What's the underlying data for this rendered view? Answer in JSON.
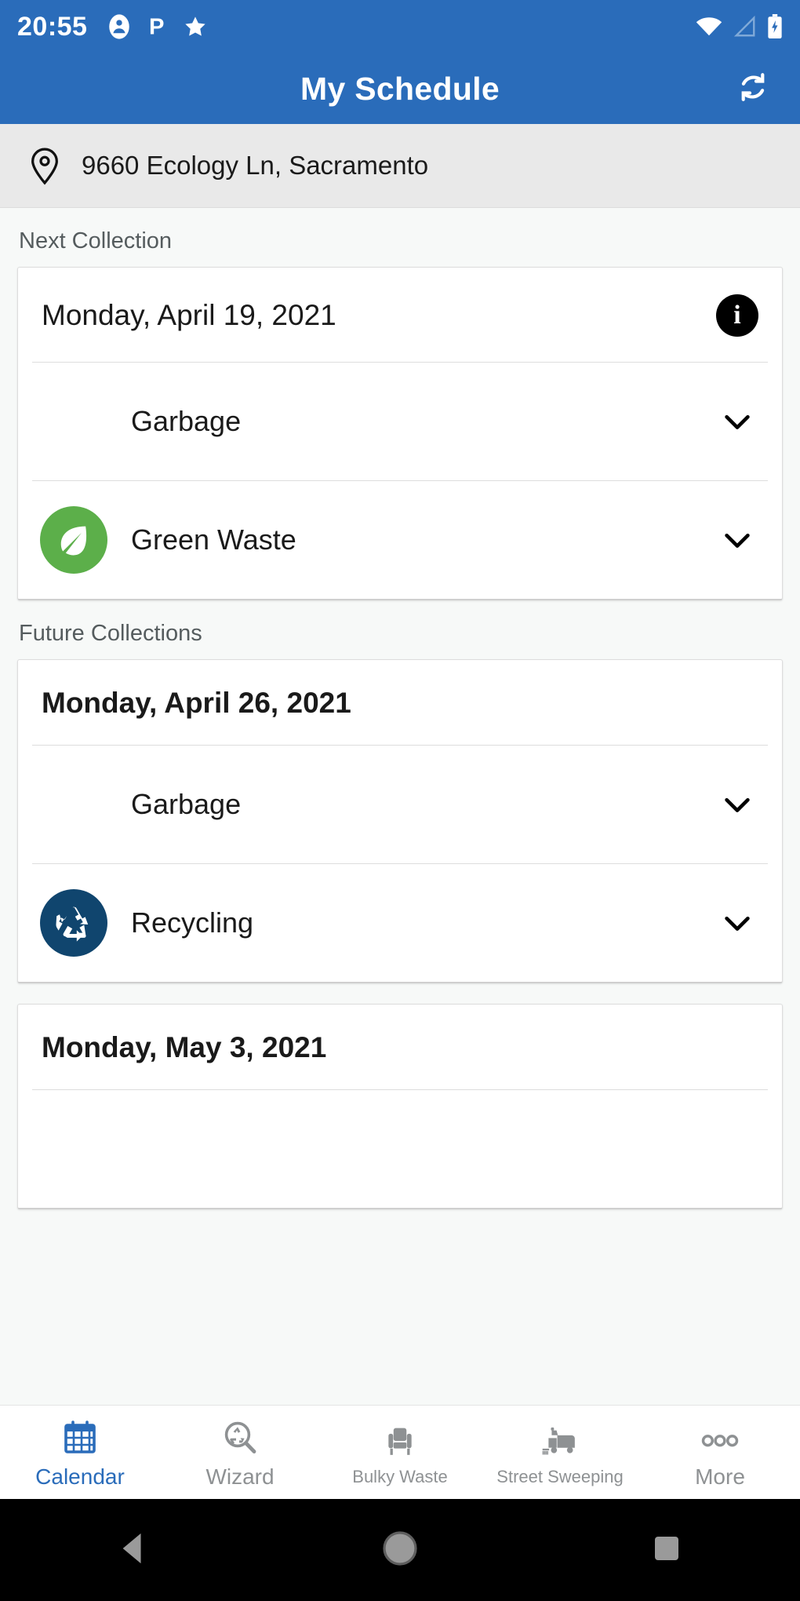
{
  "status_bar": {
    "time": "20:55",
    "left_icons": [
      "account-circle-icon",
      "parking-p-icon",
      "star-icon"
    ],
    "right_icons": [
      "wifi-icon",
      "cellular-signal-icon",
      "battery-charging-icon"
    ]
  },
  "app_bar": {
    "title": "My Schedule",
    "action_icon": "refresh-icon",
    "background_color": "#2a6cba"
  },
  "address_bar": {
    "icon": "location-pin-icon",
    "address": "9660 Ecology Ln, Sacramento"
  },
  "sections": [
    {
      "label": "Next Collection",
      "cards": [
        {
          "date": "Monday, April 19, 2021",
          "date_bold": false,
          "has_info_badge": true,
          "info_badge_label": "i",
          "services": [
            {
              "name": "Garbage",
              "icon": "none",
              "icon_color": "",
              "chevron": "chevron-down-icon"
            },
            {
              "name": "Green Waste",
              "icon": "leaf-icon",
              "icon_color": "#5CAF4A",
              "chevron": "chevron-down-icon"
            }
          ]
        }
      ]
    },
    {
      "label": "Future Collections",
      "cards": [
        {
          "date": "Monday, April 26, 2021",
          "date_bold": true,
          "has_info_badge": false,
          "info_badge_label": "",
          "services": [
            {
              "name": "Garbage",
              "icon": "none",
              "icon_color": "",
              "chevron": "chevron-down-icon"
            },
            {
              "name": "Recycling",
              "icon": "recycling-icon",
              "icon_color": "#10456E",
              "chevron": "chevron-down-icon"
            }
          ]
        },
        {
          "date": "Monday, May 3, 2021",
          "date_bold": true,
          "has_info_badge": false,
          "info_badge_label": "",
          "clipped": true,
          "services": []
        }
      ]
    }
  ],
  "tab_bar": {
    "active_color": "#2a6cba",
    "inactive_color": "#8e9193",
    "tabs": [
      {
        "label": "Calendar",
        "icon": "calendar-icon",
        "active": true,
        "size": "big"
      },
      {
        "label": "Wizard",
        "icon": "recycle-search-icon",
        "active": false,
        "size": "big"
      },
      {
        "label": "Bulky Waste",
        "icon": "armchair-icon",
        "active": false,
        "size": "small"
      },
      {
        "label": "Street Sweeping",
        "icon": "sweeper-truck-icon",
        "active": false,
        "size": "small"
      },
      {
        "label": "More",
        "icon": "more-dots-icon",
        "active": false,
        "size": "big"
      }
    ]
  },
  "nav_bar": {
    "buttons": [
      {
        "name": "back-button",
        "icon": "triangle-back-icon"
      },
      {
        "name": "home-button",
        "icon": "circle-home-icon"
      },
      {
        "name": "recents-button",
        "icon": "square-recents-icon"
      }
    ]
  }
}
